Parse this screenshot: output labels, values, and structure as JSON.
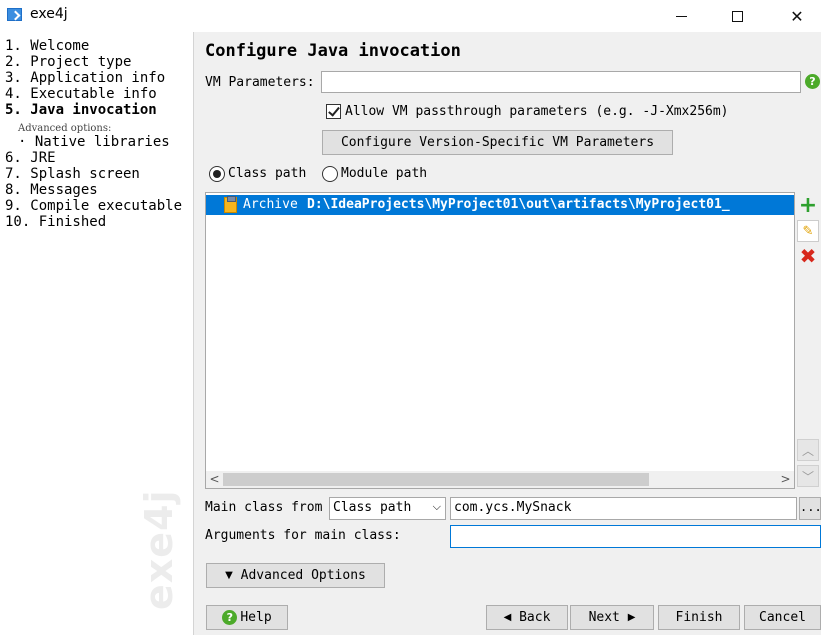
{
  "window": {
    "title": "exe4j",
    "minimize_icon": "minimize-icon",
    "maximize_icon": "maximize-icon",
    "close_icon": "close-icon"
  },
  "steps": [
    {
      "label": "1. Welcome"
    },
    {
      "label": "2. Project type"
    },
    {
      "label": "3. Application info"
    },
    {
      "label": "4. Executable info"
    },
    {
      "label": "5. Java invocation",
      "current": true
    },
    {
      "label": "Advanced options:"
    },
    {
      "label": "· Native libraries"
    },
    {
      "label": "6. JRE"
    },
    {
      "label": "7. Splash screen"
    },
    {
      "label": "8. Messages"
    },
    {
      "label": "9. Compile executable"
    },
    {
      "label": "10. Finished"
    }
  ],
  "sidebar_watermark": "exe4j",
  "page": {
    "heading": "Configure Java invocation",
    "vm_parameters_label": "VM Parameters:",
    "vm_parameters_value": "",
    "allow_passthrough_label": "Allow VM passthrough parameters (e.g. -J-Xmx256m)",
    "allow_passthrough_checked": true,
    "configure_vm_button": "Configure Version-Specific VM Parameters",
    "classpath_radio_label": "Class path",
    "modulepath_radio_label": "Module path",
    "selected_path_mode": "Class path",
    "list_items": [
      {
        "kind": "Archive",
        "path": "D:\\IdeaProjects\\MyProject01\\out\\artifacts\\MyProject01_"
      }
    ],
    "main_class_label": "Main class from",
    "main_class_source": "Class path",
    "main_class_value": "com.ycs.MySnack",
    "browse_label": "...",
    "arguments_label": "Arguments for main class:",
    "arguments_value": "",
    "advanced_options_button": "Advanced Options"
  },
  "buttons": {
    "help": "Help",
    "back": "Back",
    "next": "Next",
    "finish": "Finish",
    "cancel": "Cancel"
  },
  "colors": {
    "selection": "#0078d7",
    "add": "#2ea02e",
    "delete": "#d7281c",
    "help": "#4caa2a"
  }
}
